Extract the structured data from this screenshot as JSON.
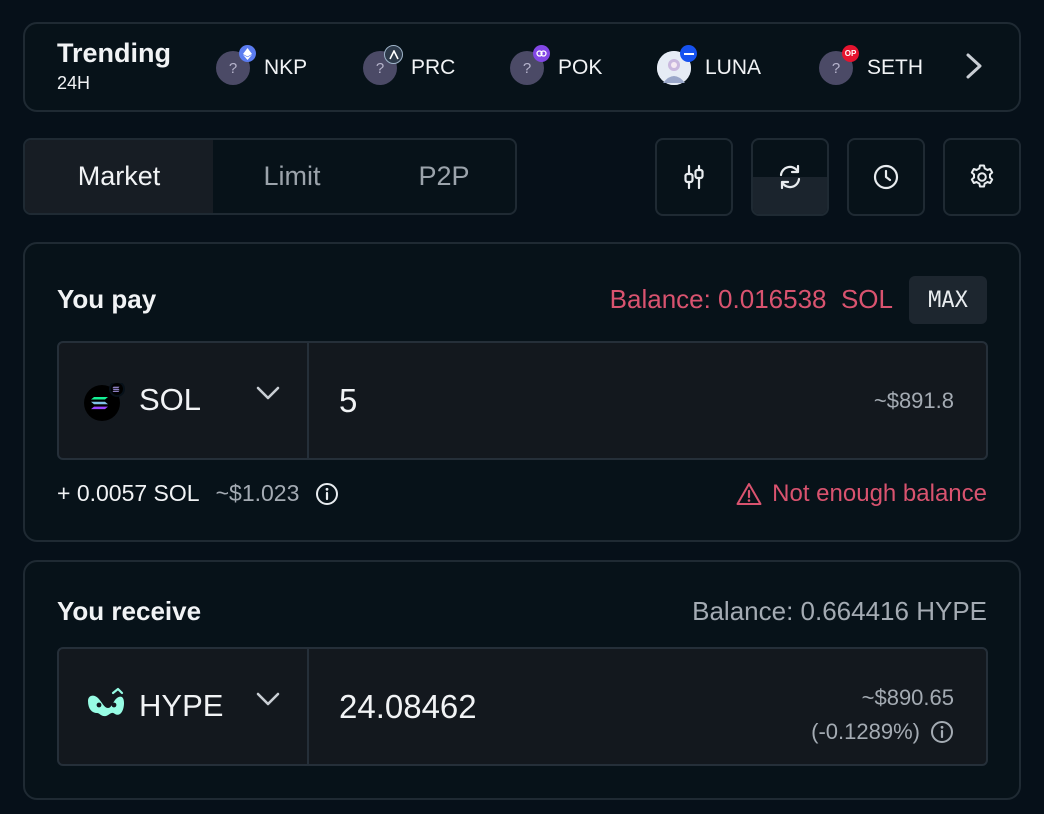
{
  "trending": {
    "title": "Trending",
    "period": "24H",
    "coins": [
      {
        "symbol": "NKP",
        "placeholder": "?",
        "badge_icon": "ethereum-badge-icon",
        "badge_color": "#5b7cf0"
      },
      {
        "symbol": "PRC",
        "placeholder": "?",
        "badge_icon": "arbitrum-badge-icon",
        "badge_color": "#2d3a4a"
      },
      {
        "symbol": "POK",
        "placeholder": "?",
        "badge_icon": "polygon-badge-icon",
        "badge_color": "#8247e5"
      },
      {
        "symbol": "LUNA",
        "placeholder": "",
        "badge_icon": "base-badge-icon",
        "badge_color": "#1652f0"
      },
      {
        "symbol": "SETH",
        "placeholder": "?",
        "badge_icon": "optimism-badge-icon",
        "badge_color": "#e5142f",
        "badge_text": "OP"
      }
    ]
  },
  "tabs": [
    {
      "label": "Market",
      "active": true
    },
    {
      "label": "Limit",
      "active": false
    },
    {
      "label": "P2P",
      "active": false
    }
  ],
  "toolbar": {
    "icons": [
      "sliders-icon",
      "refresh-icon",
      "clock-icon",
      "gear-icon"
    ],
    "refresh_progress": 0.5
  },
  "pay": {
    "title": "You pay",
    "balance_label": "Balance: 0.016538",
    "balance_symbol": "SOL",
    "max_label": "MAX",
    "token": "SOL",
    "amount": "5",
    "usd": "~$891.8",
    "fee": "+ 0.0057 SOL",
    "fee_usd": "~$1.023",
    "warning": "Not enough balance"
  },
  "receive": {
    "title": "You receive",
    "balance": "Balance: 0.664416 HYPE",
    "token": "HYPE",
    "amount": "24.08462",
    "usd": "~$890.65",
    "impact": "(-0.1289%)"
  },
  "colors": {
    "background": "#061019",
    "warning": "#d9536f",
    "hype_accent": "#97fce4"
  }
}
